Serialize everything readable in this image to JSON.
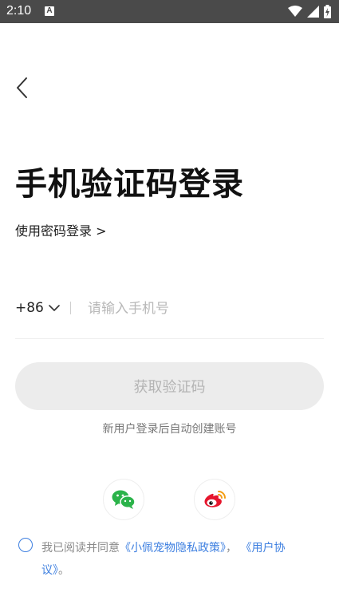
{
  "status_bar": {
    "time": "2:10",
    "notification_icon": "A"
  },
  "nav": {
    "back_icon": "chevron-left-icon"
  },
  "title": "手机验证码登录",
  "password_login_link": "使用密码登录 >",
  "phone": {
    "country_code": "+86",
    "placeholder": "请输入手机号",
    "value": ""
  },
  "get_code_button": "获取验证码",
  "hint": "新用户登录后自动创建账号",
  "social": {
    "wechat": "wechat-icon",
    "weibo": "weibo-icon"
  },
  "agreement": {
    "checked": false,
    "prefix": "我已阅读并同意",
    "privacy_link": "《小佩宠物隐私政策》",
    "separator": "，",
    "user_link": "《用户协议》",
    "suffix": "。"
  },
  "colors": {
    "status_bar": "#4a4a4a",
    "link": "#3d7fe0",
    "button_bg": "#ececec",
    "button_text": "#b4b4b4",
    "wechat": "#2bb34a",
    "weibo": "#e6162d"
  }
}
